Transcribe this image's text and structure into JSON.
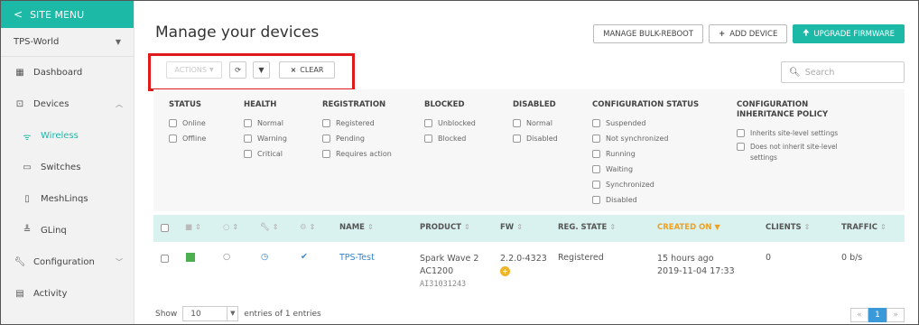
{
  "sidebar": {
    "site_menu": "SITE MENU",
    "org": "TPS-World",
    "items": [
      {
        "label": "Dashboard",
        "icon": "dashboard-icon"
      },
      {
        "label": "Devices",
        "icon": "devices-icon"
      },
      {
        "label": "Wireless",
        "icon": "wifi-icon"
      },
      {
        "label": "Switches",
        "icon": "switch-icon"
      },
      {
        "label": "MeshLinqs",
        "icon": "meshlinq-icon"
      },
      {
        "label": "GLinq",
        "icon": "glinq-icon"
      },
      {
        "label": "Configuration",
        "icon": "wrench-icon"
      },
      {
        "label": "Activity",
        "icon": "activity-icon"
      }
    ]
  },
  "header": {
    "title": "Manage your devices",
    "bulk_reboot": "MANAGE BULK-REBOOT",
    "add_device": "ADD DEVICE",
    "upgrade_firmware": "UPGRADE FIRMWARE"
  },
  "toolbar": {
    "actions": "ACTIONS",
    "clear": "CLEAR",
    "search_placeholder": "Search"
  },
  "filters": {
    "status": {
      "title": "STATUS",
      "options": [
        "Online",
        "Offline"
      ]
    },
    "health": {
      "title": "HEALTH",
      "options": [
        "Normal",
        "Warning",
        "Critical"
      ]
    },
    "registration": {
      "title": "REGISTRATION",
      "options": [
        "Registered",
        "Pending",
        "Requires action"
      ]
    },
    "blocked": {
      "title": "BLOCKED",
      "options": [
        "Unblocked",
        "Blocked"
      ]
    },
    "disabled": {
      "title": "DISABLED",
      "options": [
        "Normal",
        "Disabled"
      ]
    },
    "config_status": {
      "title": "CONFIGURATION STATUS",
      "options": [
        "Suspended",
        "Not synchronized",
        "Running",
        "Waiting",
        "Synchronized",
        "Disabled"
      ]
    },
    "inheritance": {
      "title_line1": "CONFIGURATION",
      "title_line2": "INHERITANCE POLICY",
      "options": [
        "Inherits site-level settings",
        "Does not inherit site-level",
        "settings"
      ]
    }
  },
  "table": {
    "columns": {
      "name": "NAME",
      "product": "PRODUCT",
      "fw": "FW",
      "reg_state": "REG. STATE",
      "created_on": "CREATED ON",
      "clients": "CLIENTS",
      "traffic": "TRAFFIC"
    },
    "row": {
      "name": "TPS-Test",
      "product_line1": "Spark Wave 2",
      "product_line2": "AC1200",
      "serial": "AI31031243",
      "fw": "2.2.0-4323",
      "reg_state": "Registered",
      "created_line1": "15 hours ago",
      "created_line2": "2019-11-04 17:33",
      "clients": "0",
      "traffic": "0 b/s"
    }
  },
  "footer": {
    "show": "Show",
    "page_size": "10",
    "entries": "entries of 1 entries",
    "current_page": "1"
  },
  "colors": {
    "accent": "#1bb9a6",
    "highlight": "#e0191b",
    "link": "#3a84c7",
    "sorted": "#f0a020"
  }
}
